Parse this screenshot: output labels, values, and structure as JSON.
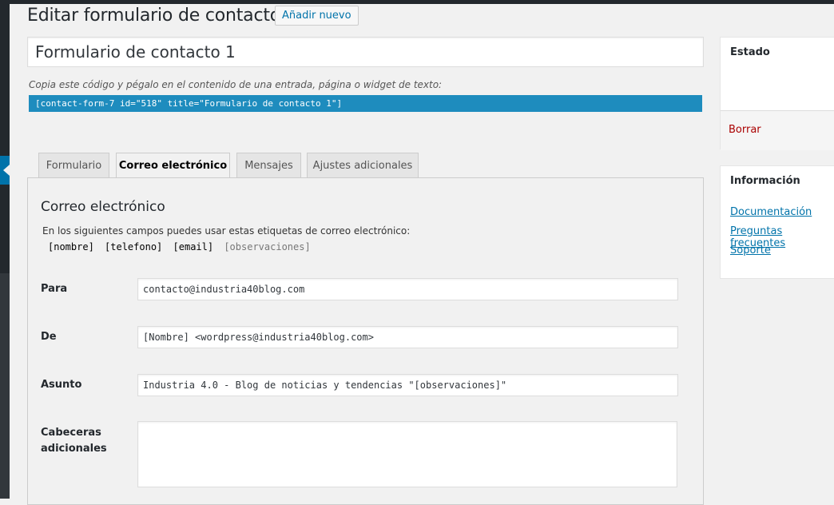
{
  "page": {
    "title": "Editar formulario de contacto",
    "add_new_label": "Añadir nuevo"
  },
  "form": {
    "title_value": "Formulario de contacto 1",
    "shortcode_hint": "Copia este código y pégalo en el contenido de una entrada, página o widget de texto:",
    "shortcode": "[contact-form-7 id=\"518\" title=\"Formulario de contacto 1\"]"
  },
  "tabs": [
    {
      "label": "Formulario",
      "active": false
    },
    {
      "label": "Correo electrónico",
      "active": true
    },
    {
      "label": "Mensajes",
      "active": false
    },
    {
      "label": "Ajustes adicionales",
      "active": false
    }
  ],
  "mail": {
    "heading": "Correo electrónico",
    "description": "En los siguientes campos puedes usar estas etiquetas de correo electrónico:",
    "tags": [
      {
        "text": "[nombre]",
        "used": true
      },
      {
        "text": "[telefono]",
        "used": true
      },
      {
        "text": "[email]",
        "used": true
      },
      {
        "text": "[observaciones]",
        "used": false
      }
    ],
    "fields": {
      "to": {
        "label": "Para",
        "value": "contacto@industria40blog.com"
      },
      "from": {
        "label": "De",
        "value": "[Nombre] <wordpress@industria40blog.com>"
      },
      "subject": {
        "label": "Asunto",
        "value": "Industria 4.0 - Blog de noticias y tendencias \"[observaciones]\""
      },
      "headers": {
        "label_line1": "Cabeceras",
        "label_line2": "adicionales",
        "value": ""
      }
    }
  },
  "sidebar": {
    "status": {
      "title": "Estado",
      "delete_label": "Borrar"
    },
    "info": {
      "title": "Información",
      "links": [
        "Documentación",
        "Preguntas frecuentes",
        "Soporte"
      ]
    }
  },
  "colors": {
    "shortcode_bg": "#1e8cbe",
    "link": "#0073aa",
    "delete": "#a00000",
    "admin_menu": "#23282d"
  }
}
